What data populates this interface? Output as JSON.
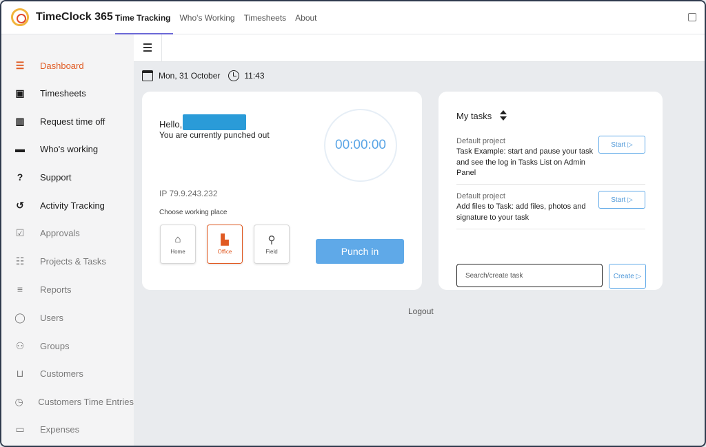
{
  "app": {
    "title": "TimeClock 365"
  },
  "top_nav": [
    "Time Tracking",
    "Who's Working",
    "Timesheets",
    "About"
  ],
  "sidebar": {
    "items": [
      {
        "label": "Dashboard",
        "icon": "list-icon"
      },
      {
        "label": "Timesheets",
        "icon": "timesheet-icon"
      },
      {
        "label": "Request time off",
        "icon": "map-icon"
      },
      {
        "label": "Who's working",
        "icon": "briefcase-icon"
      },
      {
        "label": "Support",
        "icon": "question-icon"
      },
      {
        "label": "Activity Tracking",
        "icon": "history-icon"
      },
      {
        "label": "Approvals",
        "icon": "checkbox-icon"
      },
      {
        "label": "Projects & Tasks",
        "icon": "checklist-icon"
      },
      {
        "label": "Reports",
        "icon": "lines-icon"
      },
      {
        "label": "Users",
        "icon": "user-icon"
      },
      {
        "label": "Groups",
        "icon": "group-icon"
      },
      {
        "label": "Customers",
        "icon": "cart-icon"
      },
      {
        "label": "Customers Time Entries",
        "icon": "clock-icon"
      },
      {
        "label": "Expenses",
        "icon": "money-icon"
      }
    ]
  },
  "header": {
    "date": "Mon, 31 October",
    "time": "11:43"
  },
  "punch_card": {
    "greeting": "Hello,",
    "status": "You are currently punched out",
    "timer": "00:00:00",
    "ip": "IP 79.9.243.232",
    "choose_label": "Choose working place",
    "places": [
      {
        "label": "Home",
        "icon": "home-icon"
      },
      {
        "label": "Office",
        "icon": "building-icon",
        "selected": true
      },
      {
        "label": "Field",
        "icon": "pin-icon"
      }
    ],
    "punch_button": "Punch in"
  },
  "tasks": {
    "title": "My tasks",
    "items": [
      {
        "project": "Default project",
        "description": "Task Example: start and pause your task and see the log in Tasks List on Admin Panel",
        "button": "Start ▷"
      },
      {
        "project": "Default project",
        "description": "Add files to Task: add files, photos and signature to your task",
        "button": "Start ▷"
      }
    ],
    "search_placeholder": "Search/create task",
    "create_button": "Create ▷"
  },
  "logout": "Logout",
  "colors": {
    "accent_orange": "#e05a22",
    "accent_blue": "#5fa9e8",
    "tab_underline": "#6b68d6"
  }
}
